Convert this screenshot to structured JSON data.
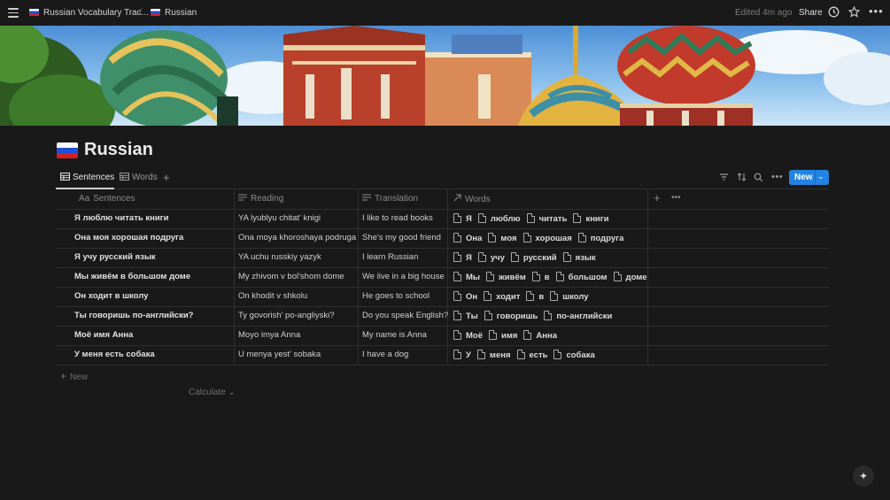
{
  "topbar": {
    "breadcrumb_parent": "Russian Vocabulary Trac...",
    "breadcrumb_separator": "/",
    "breadcrumb_current": "Russian",
    "edited": "Edited 4m ago",
    "share": "Share"
  },
  "page": {
    "title": "Russian"
  },
  "tabs": [
    {
      "label": "Sentences",
      "active": true
    },
    {
      "label": "Words",
      "active": false
    }
  ],
  "toolbar": {
    "new_label": "New"
  },
  "table": {
    "columns": [
      {
        "label": "Sentences",
        "icon": "Aa"
      },
      {
        "label": "Reading"
      },
      {
        "label": "Translation"
      },
      {
        "label": "Words"
      }
    ],
    "rows": [
      {
        "sentence": "Я люблю читать книги",
        "reading": "YA lyublyu chitat' knigi",
        "translation": "I like to read books",
        "words": [
          "Я",
          "люблю",
          "читать",
          "книги"
        ]
      },
      {
        "sentence": "Она моя хорошая подруга",
        "reading": "Ona moya khoroshaya podruga",
        "translation": "She's my good friend",
        "words": [
          "Она",
          "моя",
          "хорошая",
          "подруга"
        ]
      },
      {
        "sentence": "Я учу русский язык",
        "reading": "YA uchu russkiy yazyk",
        "translation": "I learn Russian",
        "words": [
          "Я",
          "учу",
          "русский",
          "язык"
        ]
      },
      {
        "sentence": "Мы живём в большом доме",
        "reading": "My zhivom v bol'shom dome",
        "translation": "We live in a big house",
        "words": [
          "Мы",
          "живём",
          "в",
          "большом",
          "доме"
        ]
      },
      {
        "sentence": "Он ходит в школу",
        "reading": "On khodit v shkolu",
        "translation": "He goes to school",
        "words": [
          "Он",
          "ходит",
          "в",
          "школу"
        ]
      },
      {
        "sentence": "Ты говоришь по-английски?",
        "reading": "Ty govorish' po-angliyski?",
        "translation": "Do you speak English?",
        "words": [
          "Ты",
          "говоришь",
          "по-английски"
        ]
      },
      {
        "sentence": "Моё имя Анна",
        "reading": "Moyo imya Anna",
        "translation": "My name is Anna",
        "words": [
          "Моё",
          "имя",
          "Анна"
        ]
      },
      {
        "sentence": "У меня есть собака",
        "reading": "U menya yest' sobaka",
        "translation": "I have a dog",
        "words": [
          "У",
          "меня",
          "есть",
          "собака"
        ]
      }
    ],
    "add_row_label": "New",
    "calculate_label": "Calculate"
  },
  "icons": {
    "menu": "hamburger-icon",
    "updates": "clock-icon",
    "favorite": "star-icon",
    "more": "ellipsis-icon",
    "filter": "filter-icon",
    "sort": "sort-icon",
    "search": "search-icon",
    "help": "sparkle-icon",
    "page": "document-icon"
  },
  "colors": {
    "background": "#191919",
    "accent": "#2383e2",
    "text": "#d4d4d4",
    "muted": "#8b8b8b"
  }
}
